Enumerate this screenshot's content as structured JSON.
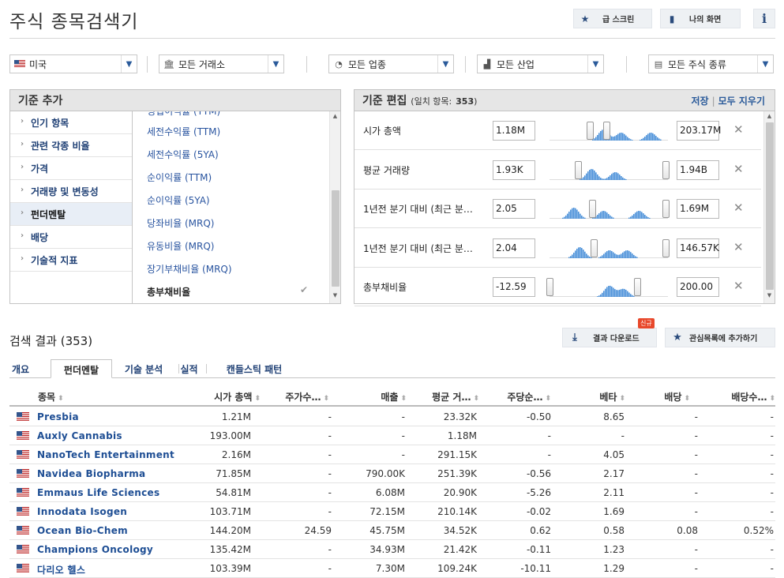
{
  "header": {
    "title": "주식 종목검색기",
    "my_screens_label": "급 스크린",
    "my_view_label": "나의 화면",
    "info_label": "i"
  },
  "filters": {
    "country": "미국",
    "exchange": "모든 거래소",
    "sector": "모든 업종",
    "industry": "모든 산업",
    "stock_type": "모든 주식 종류"
  },
  "criteria_panel": {
    "title": "기준 추가",
    "categories": [
      {
        "label": "인기 항목"
      },
      {
        "label": "관련 각종 비율"
      },
      {
        "label": "가격"
      },
      {
        "label": "거래량 및 변동성"
      },
      {
        "label": "펀더멘탈",
        "selected": true
      },
      {
        "label": "배당"
      },
      {
        "label": "기술적 지표"
      }
    ],
    "items": [
      {
        "label": "세전수익률 (TTM)"
      },
      {
        "label": "세전수익률 (5YA)"
      },
      {
        "label": "순이익률 (TTM)"
      },
      {
        "label": "순이익률 (5YA)"
      },
      {
        "label": "당좌비율 (MRQ)"
      },
      {
        "label": "유동비율 (MRQ)"
      },
      {
        "label": "장기부채비율 (MRQ)"
      },
      {
        "label": "총부채비율",
        "selected": true
      }
    ]
  },
  "edit_panel": {
    "title": "기준 편집",
    "match_label": "(일치 항목:",
    "match_count": "353",
    "match_close": ")",
    "save_label": "저장",
    "clear_label": "모두 지우기",
    "rows": [
      {
        "label": "시가 총액",
        "min": "1.18M",
        "max": "203.17M",
        "lo": 0.34,
        "hi": 0.48
      },
      {
        "label": "평균 거래량",
        "min": "1.93K",
        "max": "1.94B",
        "lo": 0.24,
        "hi": 0.98
      },
      {
        "label": "1년전 분기 대비 (최근 분…",
        "min": "2.05",
        "max": "1.69M",
        "lo": 0.36,
        "hi": 0.98
      },
      {
        "label": "1년전 분기 대비 (최근 분…",
        "min": "2.04",
        "max": "146.57K",
        "lo": 0.37,
        "hi": 0.98
      },
      {
        "label": "총부채비율",
        "min": "-12.59",
        "max": "200.00",
        "lo": 0.0,
        "hi": 0.74
      }
    ]
  },
  "results": {
    "title": "검색 결과 (353)",
    "download_label": "결과 다운로드",
    "watchlist_label": "관심목록에 추가하기",
    "new_badge": "신규",
    "tabs": [
      "개요",
      "펀더멘탈",
      "기술 분석",
      "실적",
      "캔들스틱 패턴"
    ],
    "columns": [
      "종목",
      "시가 총액",
      "주가수…",
      "매출",
      "평균 거…",
      "주당순…",
      "베타",
      "배당",
      "배당수…"
    ],
    "rows": [
      {
        "name": "Presbia",
        "cells": [
          "1.21M",
          "-",
          "-",
          "23.32K",
          "-0.50",
          "8.65",
          "-",
          "-"
        ]
      },
      {
        "name": "Auxly Cannabis",
        "cells": [
          "193.00M",
          "-",
          "-",
          "1.18M",
          "-",
          "-",
          "-",
          "-"
        ]
      },
      {
        "name": "NanoTech Entertainment",
        "cells": [
          "2.16M",
          "-",
          "-",
          "291.15K",
          "-",
          "4.05",
          "-",
          "-"
        ]
      },
      {
        "name": "Navidea Biopharma",
        "cells": [
          "71.85M",
          "-",
          "790.00K",
          "251.39K",
          "-0.56",
          "2.17",
          "-",
          "-"
        ]
      },
      {
        "name": "Emmaus Life Sciences",
        "cells": [
          "54.81M",
          "-",
          "6.08M",
          "20.90K",
          "-5.26",
          "2.11",
          "-",
          "-"
        ]
      },
      {
        "name": "Innodata Isogen",
        "cells": [
          "103.71M",
          "-",
          "72.15M",
          "210.14K",
          "-0.02",
          "1.69",
          "-",
          "-"
        ]
      },
      {
        "name": "Ocean Bio-Chem",
        "cells": [
          "144.20M",
          "24.59",
          "45.75M",
          "34.52K",
          "0.62",
          "0.58",
          "0.08",
          "0.52%"
        ]
      },
      {
        "name": "Champions Oncology",
        "cells": [
          "135.42M",
          "-",
          "34.93M",
          "21.42K",
          "-0.11",
          "1.23",
          "-",
          "-"
        ]
      },
      {
        "name": "다리오 헬스",
        "cells": [
          "103.39M",
          "-",
          "7.30M",
          "109.24K",
          "-10.11",
          "1.29",
          "-",
          "-"
        ]
      }
    ]
  },
  "colors": {
    "accent": "#1e4e94",
    "histogram": "#4a90d9",
    "panel_header": "#e6e6e6"
  }
}
